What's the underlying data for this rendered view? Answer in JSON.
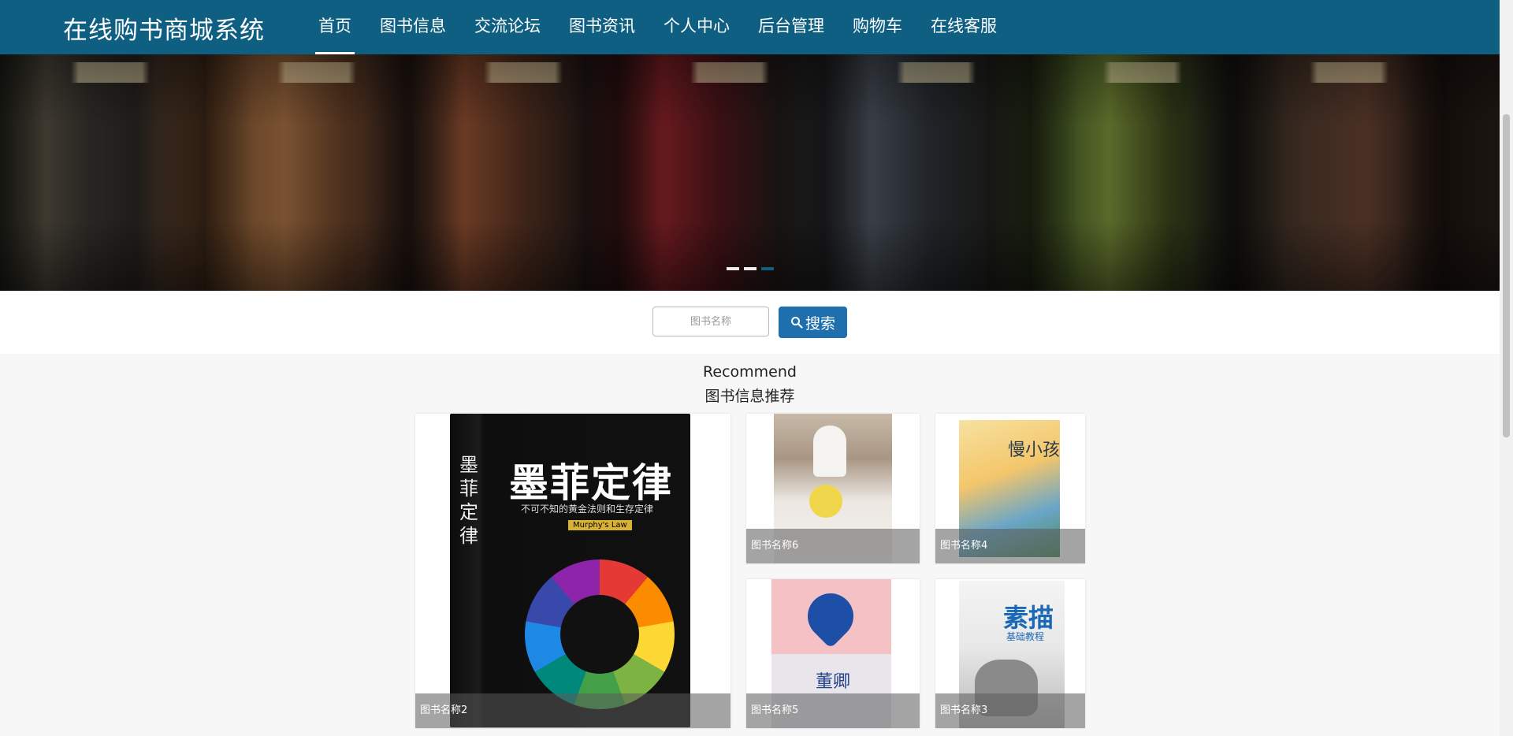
{
  "nav": {
    "brand": "在线购书商城系统",
    "items": [
      {
        "label": "首页",
        "active": true
      },
      {
        "label": "图书信息"
      },
      {
        "label": "交流论坛"
      },
      {
        "label": "图书资讯"
      },
      {
        "label": "个人中心"
      },
      {
        "label": "后台管理"
      },
      {
        "label": "购物车"
      },
      {
        "label": "在线客服"
      }
    ]
  },
  "carousel": {
    "slides": 3,
    "active_index": 2
  },
  "search": {
    "placeholder": "图书名称",
    "button_label": "搜索",
    "button_icon": "search-icon"
  },
  "recommend": {
    "title_en": "Recommend",
    "title_zh": "图书信息推荐",
    "books": [
      {
        "name": "图书名称2",
        "cover_title": "墨菲定律",
        "cover_subtitle": "不可不知的黄金法则和生存定律",
        "cover_tag": "Murphy's Law"
      },
      {
        "name": "图书名称6"
      },
      {
        "name": "图书名称4",
        "cover_title": "慢小孩"
      },
      {
        "name": "图书名称5",
        "cover_title": "董卿"
      },
      {
        "name": "图书名称3",
        "cover_title": "素描",
        "cover_subtitle": "基础教程"
      }
    ]
  },
  "colors": {
    "nav_bg": "#0e5f82",
    "search_button": "#1d6fae",
    "dot_active": "#0e5f82"
  }
}
